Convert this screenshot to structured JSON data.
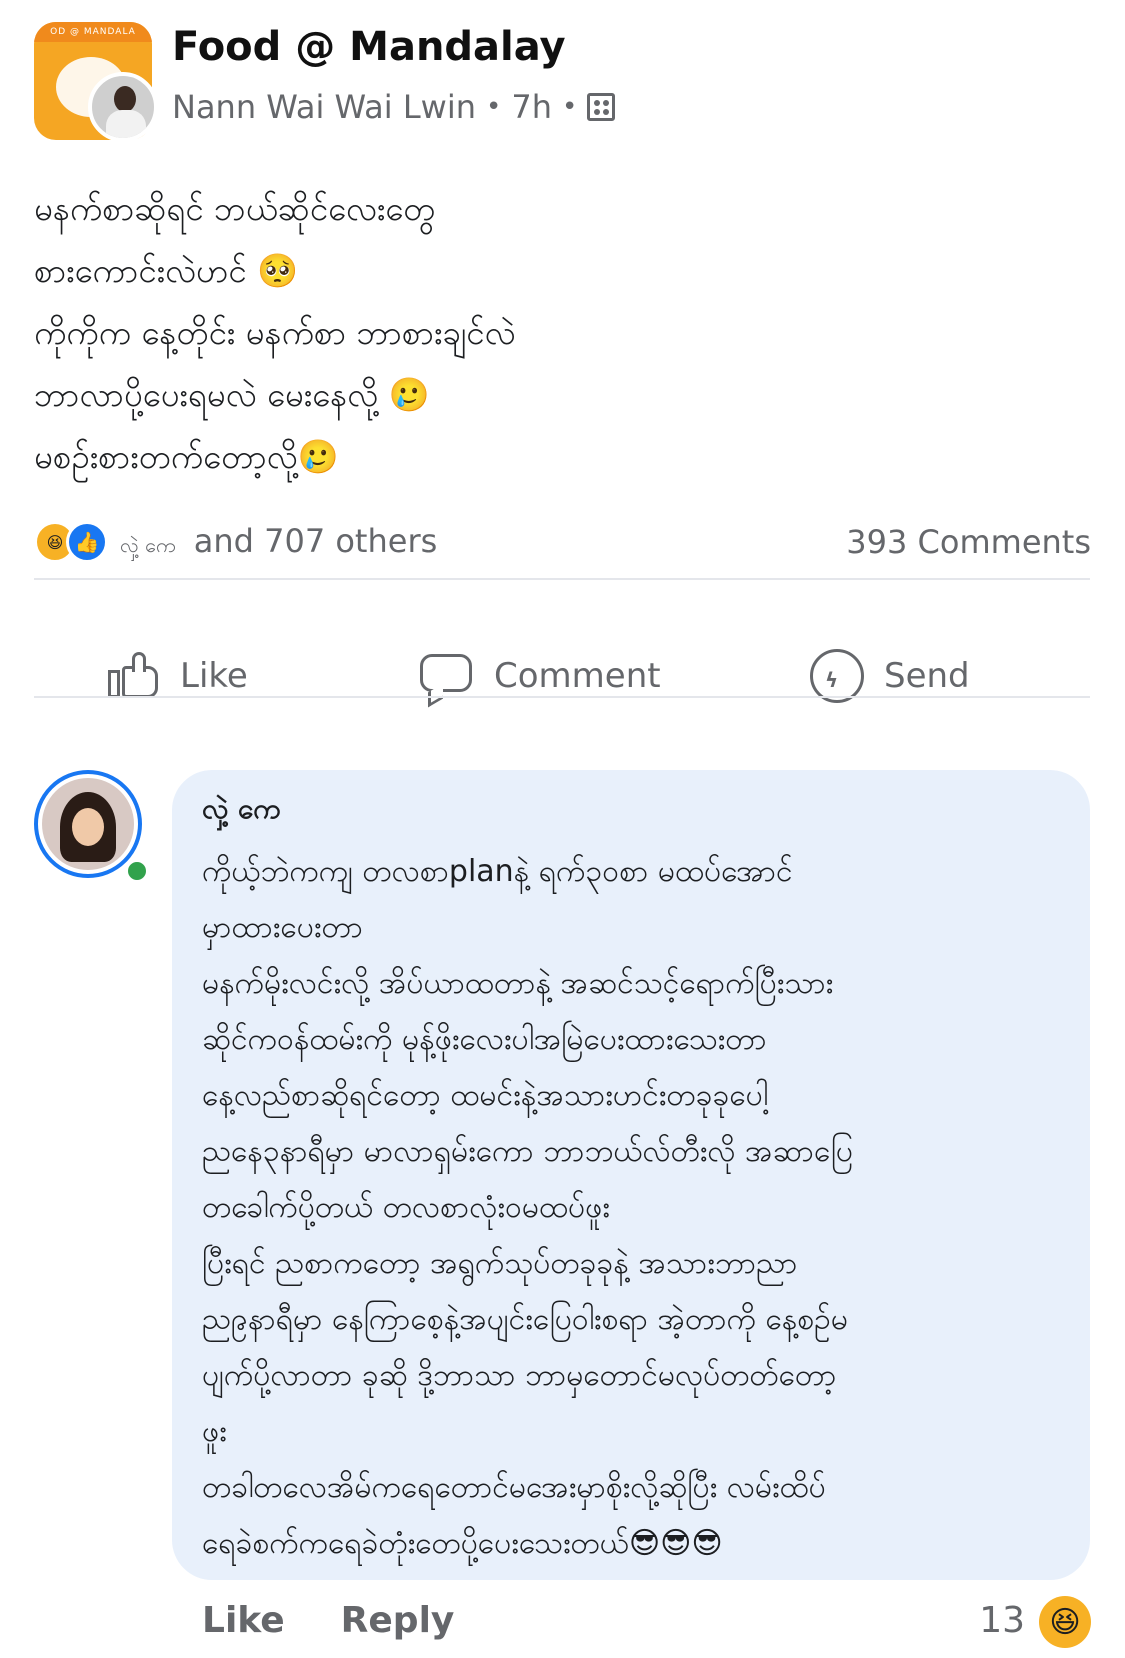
{
  "post": {
    "group_name": "Food @ Mandalay",
    "author": "Nann Wai Wai Lwin",
    "separator": "•",
    "time": "7h",
    "group_avatar_strip": "OD @ MANDALA",
    "text_lines": [
      "မနက်စာဆိုရင် ဘယ်ဆိုင်လေးတွေ",
      "စားကောင်းလဲဟင် 🥺",
      "ကိုကိုက နေ့တိုင်း မနက်စာ ဘာစားချင်လဲ",
      "ဘာလာပို့ပေးရမလဲ မေးနေလို့ 🥲",
      "မစဉ်းစားတက်တော့လို့🥲"
    ]
  },
  "reactions": {
    "names": "လှဲ့ ကေ",
    "summary": "and 707 others",
    "comments": "393 Comments",
    "haha_icon": "😆",
    "like_icon": "👍"
  },
  "actions": {
    "like": "Like",
    "comment": "Comment",
    "send": "Send"
  },
  "comment": {
    "author": "လှဲ့ ကေ",
    "lines": [
      "ကိုယ့်ဘဲကကျ တလစာplanနဲ့ ရက်၃၀စာ မထပ်အောင်",
      "မှာထားပေးတာ",
      "မနက်မိုးလင်းလို့ အိပ်ယာထတာနဲ့ အဆင်သင့်ရောက်ပြီးသား",
      "ဆိုင်ကဝန်ထမ်းကို မုန့်ဖိုးလေးပါအမြဲပေးထားသေးတာ",
      "နေ့လည်စာဆိုရင်တော့ ထမင်းနဲ့အသားဟင်းတခုခုပေါ့",
      "ညနေ၃နာရီမှာ မာလာရှမ်းကော ဘာဘယ်လ်တီးလို အဆာပြေ",
      "တခေါက်ပို့တယ် တလစာလုံးဝမထပ်ဖူး",
      "ပြီးရင် ညစာကတော့ အရွက်သုပ်တခုခုနဲ့ အသားဘာညာ",
      "ည၉နာရီမှာ နေကြာစေ့နဲ့အပျင်းပြေဝါးစရာ အဲ့တာကို နေ့စဉ်မ",
      "ပျက်ပို့လာတာ ခုဆို ဒို့ဘာသာ ဘာမှတောင်မလုပ်တတ်တော့",
      "ဖူး",
      "တခါတလေအိမ်ကရေတောင်မအေးမှာစိုးလို့ဆိုပြီး လမ်းထိပ်",
      "ရေခဲစက်ကရေခဲတုံးတေပို့ပေးသေးတယ်😎😎😎"
    ],
    "like": "Like",
    "reply": "Reply",
    "reaction_count": "13",
    "reaction_icon": "😆"
  },
  "colors": {
    "meta_gray": "#65676b",
    "bubble_bg": "#e8f0fb",
    "like_blue": "#1877f2",
    "haha_yellow": "#f7b125",
    "online_green": "#31a24c"
  },
  "icons": {
    "like": "thumbs-up-icon",
    "comment": "speech-bubble-icon",
    "send": "messenger-icon",
    "privacy": "group-members-icon"
  }
}
